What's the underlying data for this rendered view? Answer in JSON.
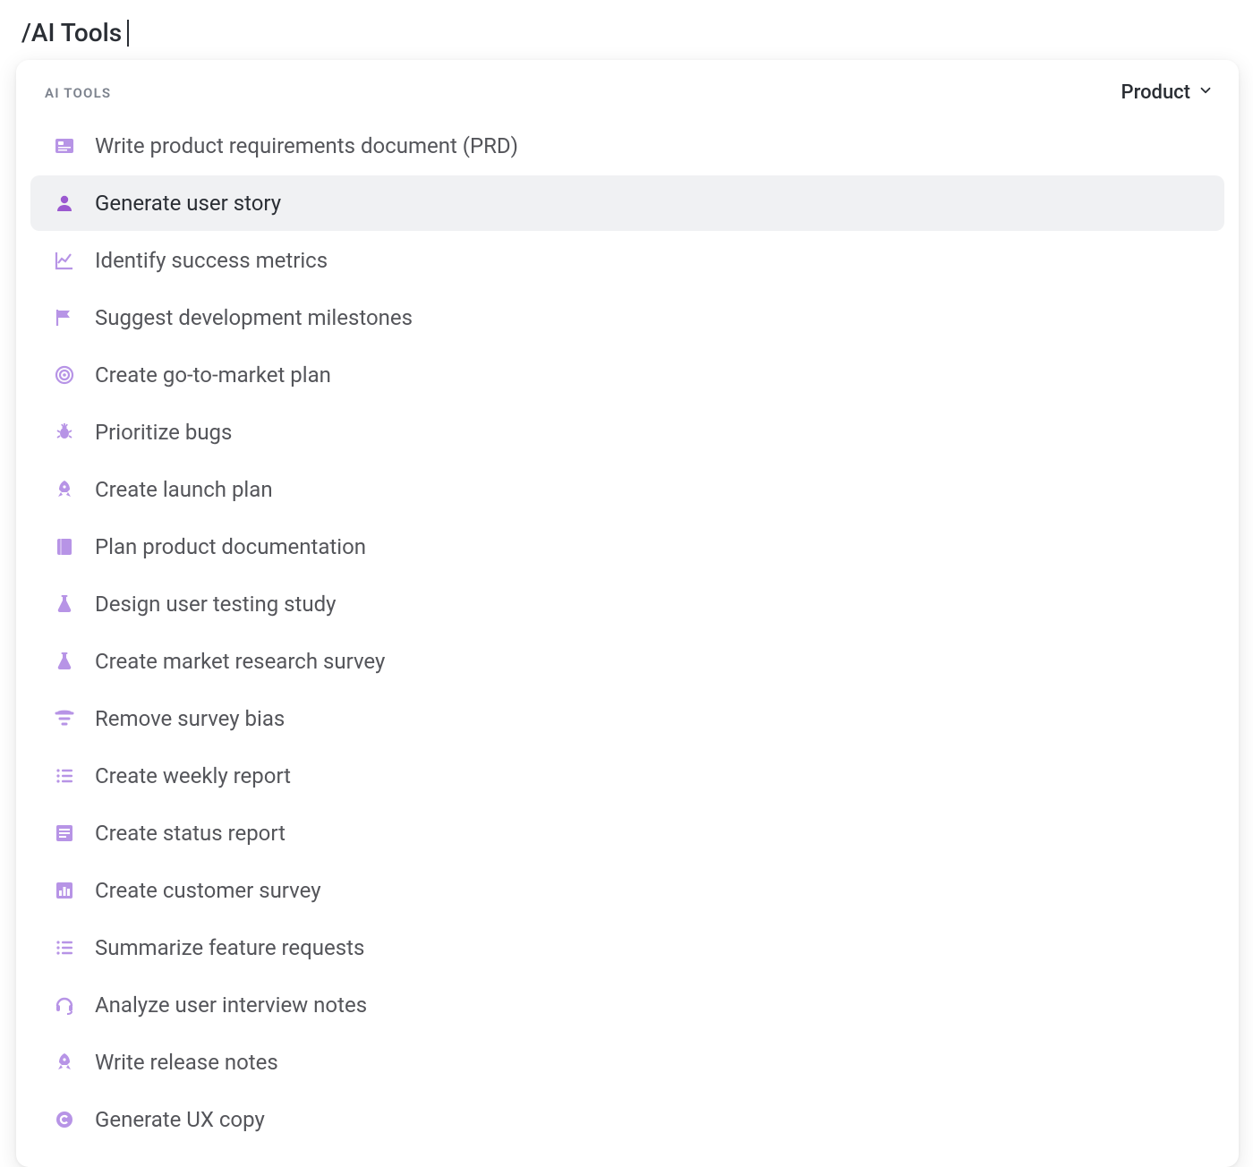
{
  "command_input": "/AI Tools",
  "panel": {
    "section_title": "AI TOOLS",
    "category": "Product",
    "items": [
      {
        "icon": "id-card-icon",
        "label": "Write product requirements document (PRD)",
        "active": false
      },
      {
        "icon": "person-icon",
        "label": "Generate user story",
        "active": true
      },
      {
        "icon": "chart-line-icon",
        "label": "Identify success metrics",
        "active": false
      },
      {
        "icon": "flag-icon",
        "label": "Suggest development milestones",
        "active": false
      },
      {
        "icon": "target-icon",
        "label": "Create go-to-market plan",
        "active": false
      },
      {
        "icon": "bug-icon",
        "label": "Prioritize bugs",
        "active": false
      },
      {
        "icon": "rocket-icon",
        "label": "Create launch plan",
        "active": false
      },
      {
        "icon": "book-icon",
        "label": "Plan product documentation",
        "active": false
      },
      {
        "icon": "flask-icon",
        "label": "Design user testing study",
        "active": false
      },
      {
        "icon": "flask-icon",
        "label": "Create market research survey",
        "active": false
      },
      {
        "icon": "filter-icon",
        "label": "Remove survey bias",
        "active": false
      },
      {
        "icon": "list-icon",
        "label": "Create weekly report",
        "active": false
      },
      {
        "icon": "form-icon",
        "label": "Create status report",
        "active": false
      },
      {
        "icon": "bar-chart-icon",
        "label": "Create customer survey",
        "active": false
      },
      {
        "icon": "list-icon",
        "label": "Summarize feature requests",
        "active": false
      },
      {
        "icon": "headset-icon",
        "label": "Analyze user interview notes",
        "active": false
      },
      {
        "icon": "rocket-icon",
        "label": "Write release notes",
        "active": false
      },
      {
        "icon": "copyright-icon",
        "label": "Generate UX copy",
        "active": false
      }
    ]
  },
  "colors": {
    "icon_purple": "#b794e6",
    "icon_purple_active": "#9b59d0",
    "text_muted": "#54555a",
    "active_bg": "#f0f1f3"
  }
}
